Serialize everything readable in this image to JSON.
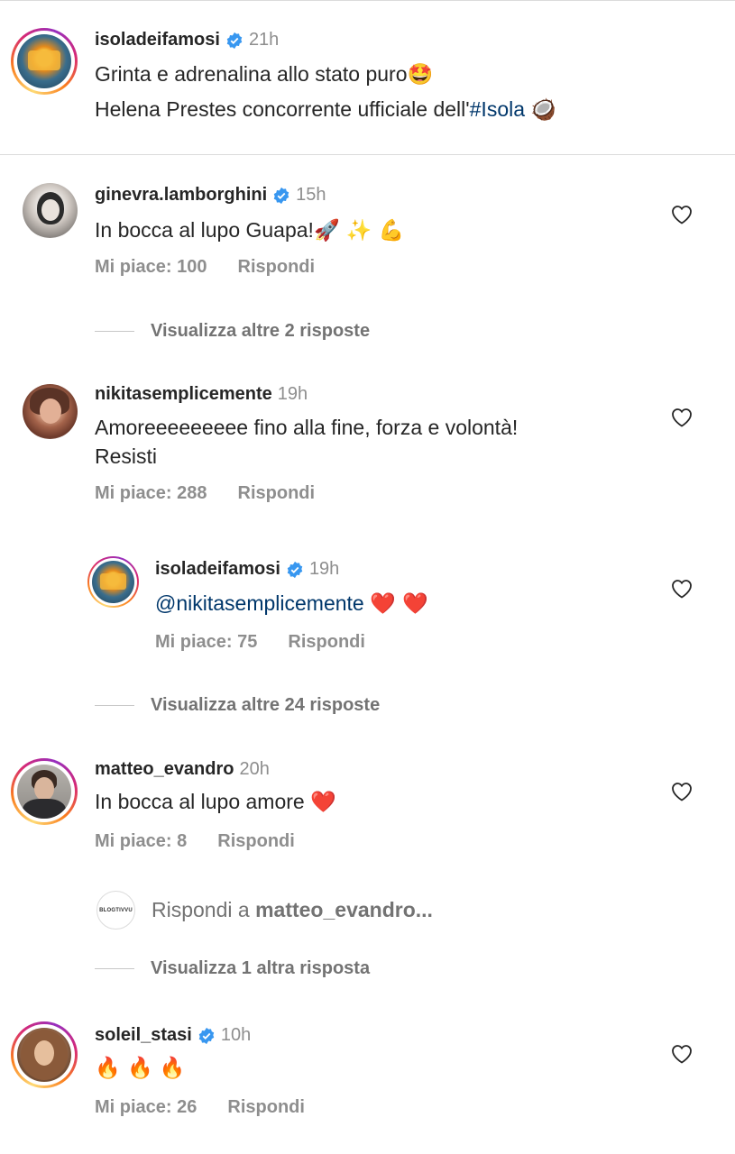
{
  "caption": {
    "username": "isoladeifamosi",
    "time": "21h",
    "line1": "Grinta e adrenalina allo stato puro",
    "line1_emoji": "🤩",
    "line2_prefix": "Helena Prestes concorrente ufficiale dell'",
    "line2_tag": "#Isola",
    "line2_emoji": "🥥"
  },
  "comments": [
    {
      "username": "ginevra.lamborghini",
      "time": "15h",
      "text": "In bocca al lupo Guapa!",
      "emoji": "🚀 ✨ 💪",
      "likes": "Mi piace: 100",
      "reply": "Rispondi",
      "more_replies": "Visualizza altre 2 risposte"
    },
    {
      "username": "nikitasemplicemente",
      "time": "19h",
      "text_line1": "Amoreeeeeeeee fino alla fine, forza e volontà!",
      "text_line2": "Resisti",
      "likes": "Mi piace: 288",
      "reply": "Rispondi"
    },
    {
      "username": "isoladeifamosi",
      "time": "19h",
      "mention": "@nikitasemplicemente",
      "emoji": "❤️ ❤️",
      "likes": "Mi piace: 75",
      "reply": "Rispondi",
      "more_replies": "Visualizza altre 24 risposte"
    },
    {
      "username": "matteo_evandro",
      "time": "20h",
      "text": "In bocca al lupo amore",
      "emoji": "❤️",
      "likes": "Mi piace: 8",
      "reply": "Rispondi",
      "reply_input_prefix": "Rispondi a ",
      "reply_input_user": "matteo_evandro...",
      "reply_avatar_text": "BLOGTIVVU",
      "more_replies": "Visualizza 1 altra risposta"
    },
    {
      "username": "soleil_stasi",
      "time": "10h",
      "emoji": "🔥 🔥 🔥",
      "likes": "Mi piace: 26",
      "reply": "Rispondi"
    }
  ],
  "colors": {
    "verified": "#3897f0",
    "link": "#00376b",
    "muted": "#8e8e8e",
    "heart_fill": "#ed4956",
    "fire": "#ff6a00"
  }
}
